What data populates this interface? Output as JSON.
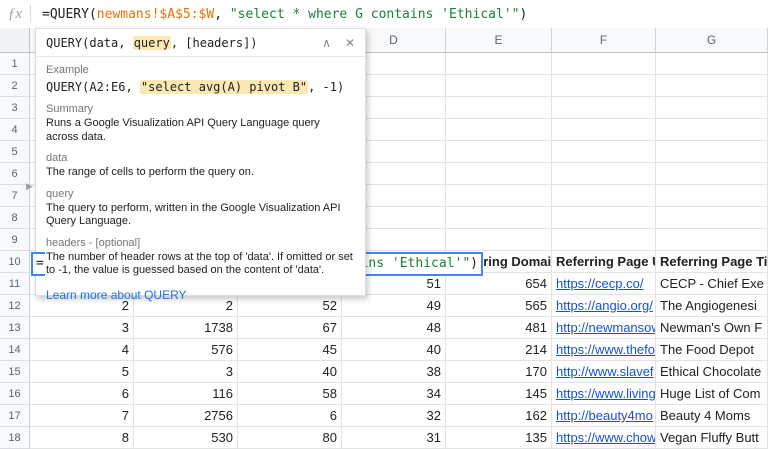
{
  "formula_bar": {
    "fx_label": "ƒx",
    "formula": {
      "prefix": "=QUERY(",
      "range": "newmans!$A$5:$W",
      "separator": ", ",
      "query_string": "\"select * where G contains 'Ethical'\"",
      "suffix": ")"
    }
  },
  "cell_editor": {
    "equals": "="
  },
  "tooltip": {
    "signature": {
      "pre": "QUERY(data, ",
      "highlight": "query",
      "post": ", [headers])"
    },
    "icons": {
      "collapse": "∧",
      "close": "✕",
      "expand": "▶"
    },
    "example": {
      "label": "Example",
      "pre": "QUERY(A2:E6, ",
      "highlight": "\"select avg(A) pivot B\"",
      "post": ", -1)"
    },
    "summary": {
      "label": "Summary",
      "text": "Runs a Google Visualization API Query Language query across data."
    },
    "args": [
      {
        "name": "data",
        "desc": "The range of cells to perform the query on."
      },
      {
        "name": "query",
        "desc": "The query to perform, written in the Google Visualization API Query Language."
      },
      {
        "name": "headers - [optional]",
        "desc": "The number of header rows at the top of 'data'. If omitted or set to -1, the value is guessed based on the content of 'data'."
      }
    ],
    "link": "Learn more about QUERY"
  },
  "grid": {
    "columns": [
      "A",
      "B",
      "C",
      "D",
      "E",
      "F",
      "G"
    ],
    "row_numbers": [
      "1",
      "2",
      "3",
      "4",
      "5",
      "6",
      "7",
      "8",
      "9",
      "10",
      "11",
      "12",
      "13",
      "14",
      "15",
      "16",
      "17",
      "18"
    ],
    "header_row": {
      "row": 10,
      "referring_domains": "Referring Domains",
      "referring_page_url": "Referring Page URL",
      "referring_page_title": "Referring Page Title"
    },
    "rows": [
      {
        "row": 11,
        "nums": [
          "",
          "",
          "",
          "51",
          "654"
        ],
        "url": "https://cecp.co/",
        "title": "CECP - Chief Exe"
      },
      {
        "row": 12,
        "nums": [
          "2",
          "2",
          "52",
          "49",
          "565"
        ],
        "url": "https://angio.org/",
        "title": "The Angiogenesi"
      },
      {
        "row": 13,
        "nums": [
          "3",
          "1738",
          "67",
          "48",
          "481"
        ],
        "url": "http://newmansow",
        "title": "Newman's Own F"
      },
      {
        "row": 14,
        "nums": [
          "4",
          "576",
          "45",
          "40",
          "214"
        ],
        "url": "https://www.thefo",
        "title": "The Food Depot"
      },
      {
        "row": 15,
        "nums": [
          "5",
          "3",
          "40",
          "38",
          "170"
        ],
        "url": "http://www.slavef",
        "title": "Ethical Chocolate"
      },
      {
        "row": 16,
        "nums": [
          "6",
          "116",
          "58",
          "34",
          "145"
        ],
        "url": "https://www.living",
        "title": "Huge List of Com"
      },
      {
        "row": 17,
        "nums": [
          "7",
          "2756",
          "6",
          "32",
          "162"
        ],
        "url": "http://beauty4mo",
        "title": "Beauty 4 Moms"
      },
      {
        "row": 18,
        "nums": [
          "8",
          "530",
          "80",
          "31",
          "135"
        ],
        "url": "https://www.chow",
        "title": "Vegan Fluffy Butt"
      }
    ]
  },
  "colors": {
    "formula_range_orange": "#e8710a",
    "formula_string_green": "#188038",
    "highlight_tan": "#fce8b2",
    "edit_border_blue": "#4285f4",
    "help_link_blue": "#1a73e8",
    "cell_link_blue": "#1155cc"
  }
}
